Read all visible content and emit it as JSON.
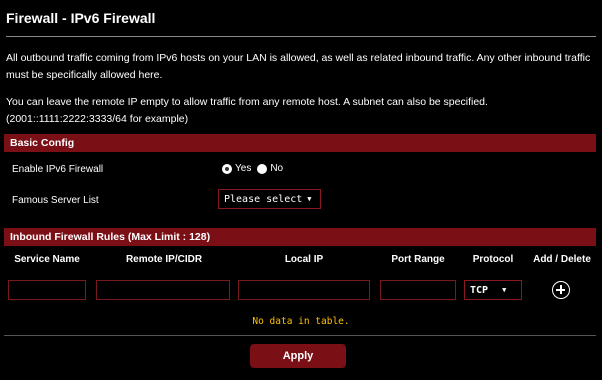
{
  "page": {
    "title": "Firewall - IPv6 Firewall",
    "description_1": "All outbound traffic coming from IPv6 hosts on your LAN is allowed, as well as related inbound traffic. Any other inbound traffic must be specifically allowed here.",
    "description_2": "You can leave the remote IP empty to allow traffic from any remote host. A subnet can also be specified. (2001::1111:2222:3333/64 for example)"
  },
  "basic_config": {
    "header": "Basic Config",
    "enable_label": "Enable IPv6 Firewall",
    "radio_yes": "Yes",
    "radio_no": "No",
    "selected": "Yes",
    "famous_label": "Famous Server List",
    "famous_value": "Please select"
  },
  "inbound_rules": {
    "header": "Inbound Firewall Rules (Max Limit : 128)",
    "columns": [
      "Service Name",
      "Remote IP/CIDR",
      "Local IP",
      "Port Range",
      "Protocol",
      "Add / Delete"
    ],
    "protocol_value": "TCP",
    "empty_message": "No data in table."
  },
  "actions": {
    "apply_label": "Apply"
  },
  "colors": {
    "accent": "#7a0f16",
    "background": "#000000",
    "empty_text": "#ffc107"
  }
}
